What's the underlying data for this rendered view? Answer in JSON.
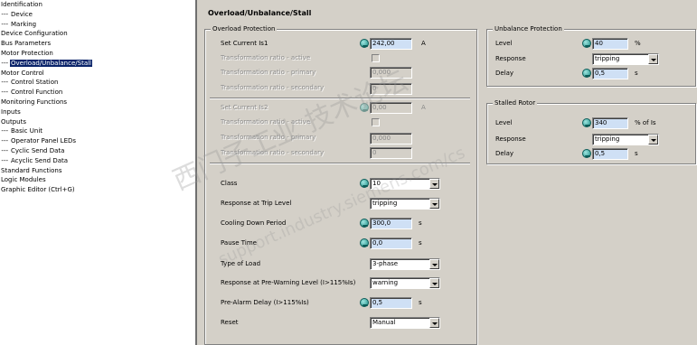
{
  "tree": {
    "items": [
      {
        "label": "Identification",
        "level": 0,
        "selected": false
      },
      {
        "label": "Device",
        "level": 1,
        "selected": false
      },
      {
        "label": "Marking",
        "level": 1,
        "selected": false
      },
      {
        "label": "Device Configuration",
        "level": 0,
        "selected": false
      },
      {
        "label": "Bus Parameters",
        "level": 0,
        "selected": false
      },
      {
        "label": "Motor Protection",
        "level": 0,
        "selected": false
      },
      {
        "label": "Overload/Unbalance/Stall",
        "level": 1,
        "selected": true
      },
      {
        "label": "Motor Control",
        "level": 0,
        "selected": false
      },
      {
        "label": "Control Station",
        "level": 1,
        "selected": false
      },
      {
        "label": "Control Function",
        "level": 1,
        "selected": false
      },
      {
        "label": "Monitoring Functions",
        "level": 0,
        "selected": false
      },
      {
        "label": "Inputs",
        "level": 0,
        "selected": false
      },
      {
        "label": "Outputs",
        "level": 0,
        "selected": false
      },
      {
        "label": "Basic Unit",
        "level": 1,
        "selected": false
      },
      {
        "label": "Operator Panel LEDs",
        "level": 1,
        "selected": false
      },
      {
        "label": "Cyclic Send Data",
        "level": 1,
        "selected": false
      },
      {
        "label": "Acyclic Send Data",
        "level": 1,
        "selected": false
      },
      {
        "label": "Standard Functions",
        "level": 0,
        "selected": false
      },
      {
        "label": "Logic Modules",
        "level": 0,
        "selected": false
      },
      {
        "label": "Graphic Editor     (Ctrl+G)",
        "level": 0,
        "selected": false
      }
    ],
    "branch_marker": "---"
  },
  "page": {
    "title": "Overload/Unbalance/Stall"
  },
  "overload": {
    "title": "Overload Protection",
    "set_current_1": {
      "label": "Set Current Is1",
      "value": "242,00",
      "unit": "A"
    },
    "tr_active_1": {
      "label": "Transformation ratio - active"
    },
    "tr_primary_1": {
      "label": "Transformation ratio - primary",
      "value": "0,000"
    },
    "tr_secondary_1": {
      "label": "Transformation ratio - secondary",
      "value": "0"
    },
    "set_current_2": {
      "label": "Set Current Is2",
      "value": "0,00",
      "unit": "A"
    },
    "tr_active_2": {
      "label": "Transformation ratio - active"
    },
    "tr_primary_2": {
      "label": "Transformation ratio - primary",
      "value": "0,000"
    },
    "tr_secondary_2": {
      "label": "Transformation ratio - secondary",
      "value": "0"
    },
    "class": {
      "label": "Class",
      "value": "10"
    },
    "response_trip": {
      "label": "Response at Trip Level",
      "value": "tripping"
    },
    "cooling": {
      "label": "Cooling Down Period",
      "value": "300,0",
      "unit": "s"
    },
    "pause": {
      "label": "Pause Time",
      "value": "0,0",
      "unit": "s"
    },
    "load_type": {
      "label": "Type of Load",
      "value": "3-phase"
    },
    "response_prewarn": {
      "label": "Response at Pre-Warning Level (I>115%Is)",
      "value": "warning"
    },
    "prealarm_delay": {
      "label": "Pre-Alarm Delay (I>115%Is)",
      "value": "0,5",
      "unit": "s"
    },
    "reset": {
      "label": "Reset",
      "value": "Manual"
    }
  },
  "unbalance": {
    "title": "Unbalance Protection",
    "level": {
      "label": "Level",
      "value": "40",
      "unit": "%"
    },
    "response": {
      "label": "Response",
      "value": "tripping"
    },
    "delay": {
      "label": "Delay",
      "value": "0,5",
      "unit": "s"
    }
  },
  "stalled": {
    "title": "Stalled Rotor",
    "level": {
      "label": "Level",
      "value": "340",
      "unit": "% of Is"
    },
    "response": {
      "label": "Response",
      "value": "tripping"
    },
    "delay": {
      "label": "Delay",
      "value": "0,5",
      "unit": "s"
    }
  },
  "watermark": {
    "line1": "西门子工业  技术论坛",
    "line2": "support.industry.siemens.com/cs"
  },
  "icons": {
    "help": "info-icon"
  },
  "colors": {
    "panel_bg": "#d4d0c8",
    "selection_bg": "#0a246a",
    "field_highlight": "#cfe0f5"
  }
}
